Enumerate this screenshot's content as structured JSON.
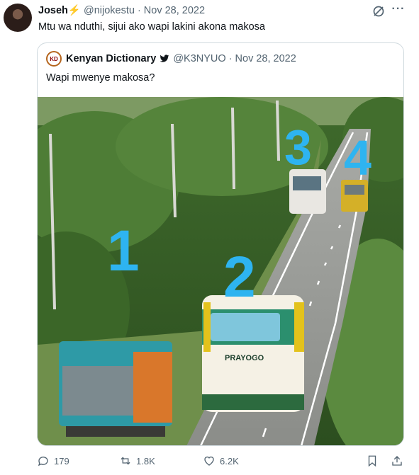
{
  "tweet": {
    "author_name": "Joseh",
    "author_emoji": "⚡",
    "handle": "@nijokestu",
    "separator": "·",
    "date": "Nov 28, 2022",
    "text": "Mtu wa nduthi, sijui ako wapi lakini akona makosa"
  },
  "quote": {
    "avatar_initials": "KD",
    "name": "Kenyan Dictionary",
    "handle": "@K3NYUO",
    "separator": "·",
    "date": "Nov 28, 2022",
    "text": "Wapi mwenye makosa?",
    "photo": {
      "numbers": [
        "1",
        "2",
        "3",
        "4"
      ],
      "bus_brand": "PRAYOGO"
    }
  },
  "actions": {
    "replies": "179",
    "reposts": "1.8K",
    "likes": "6.2K"
  },
  "colors": {
    "text": "#0f1419",
    "muted": "#536471",
    "border": "#cfd9de",
    "number_overlay": "#2eb4f0"
  }
}
